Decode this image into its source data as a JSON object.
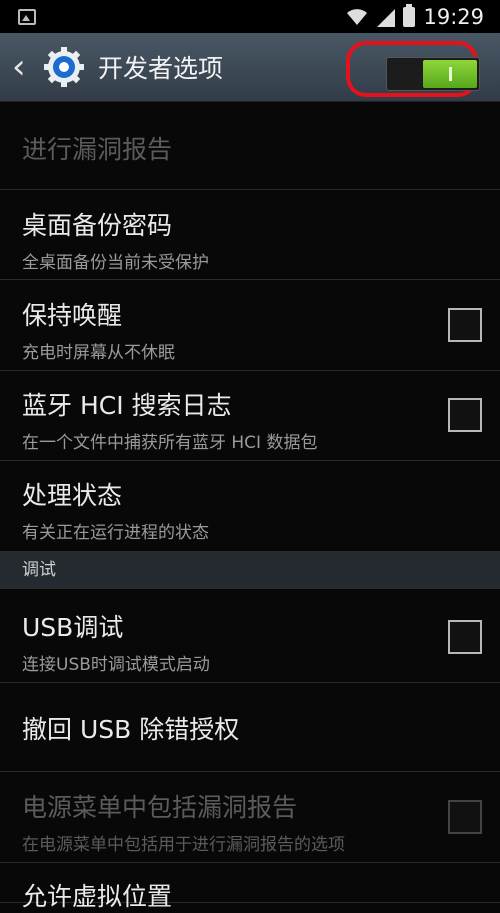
{
  "status_bar": {
    "time": "19:29"
  },
  "action_bar": {
    "back_icon": "chevron-left-icon",
    "app_icon": "gear-icon",
    "title": "开发者选项",
    "master_switch": true
  },
  "items": [
    {
      "title": "进行漏洞报告",
      "summary": "",
      "checkbox": false,
      "disabled": true
    },
    {
      "title": "桌面备份密码",
      "summary": "全桌面备份当前未受保护",
      "checkbox": false,
      "disabled": false
    },
    {
      "title": "保持唤醒",
      "summary": "充电时屏幕从不休眠",
      "checkbox": true,
      "checked": false,
      "disabled": false
    },
    {
      "title": "蓝牙 HCI 搜索日志",
      "summary": "在一个文件中捕获所有蓝牙 HCI 数据包",
      "checkbox": true,
      "checked": false,
      "disabled": false
    },
    {
      "title": "处理状态",
      "summary": "有关正在运行进程的状态",
      "checkbox": false,
      "disabled": false
    }
  ],
  "section_debug": "调试",
  "debug_items": [
    {
      "title": "USB调试",
      "summary": "连接USB时调试模式启动",
      "checkbox": true,
      "checked": false,
      "disabled": false
    },
    {
      "title": "撤回 USB 除错授权",
      "summary": "",
      "checkbox": false,
      "disabled": false
    },
    {
      "title": "电源菜单中包括漏洞报告",
      "summary": "在电源菜单中包括用于进行漏洞报告的选项",
      "checkbox": true,
      "checked": false,
      "disabled": true
    },
    {
      "title": "允许虚拟位置",
      "summary": "",
      "checkbox": false,
      "disabled": false
    }
  ],
  "colors": {
    "accent": "#6fc12a",
    "highlight": "#e5121b",
    "action_bar": "#3d4a56",
    "section": "#252a30"
  }
}
